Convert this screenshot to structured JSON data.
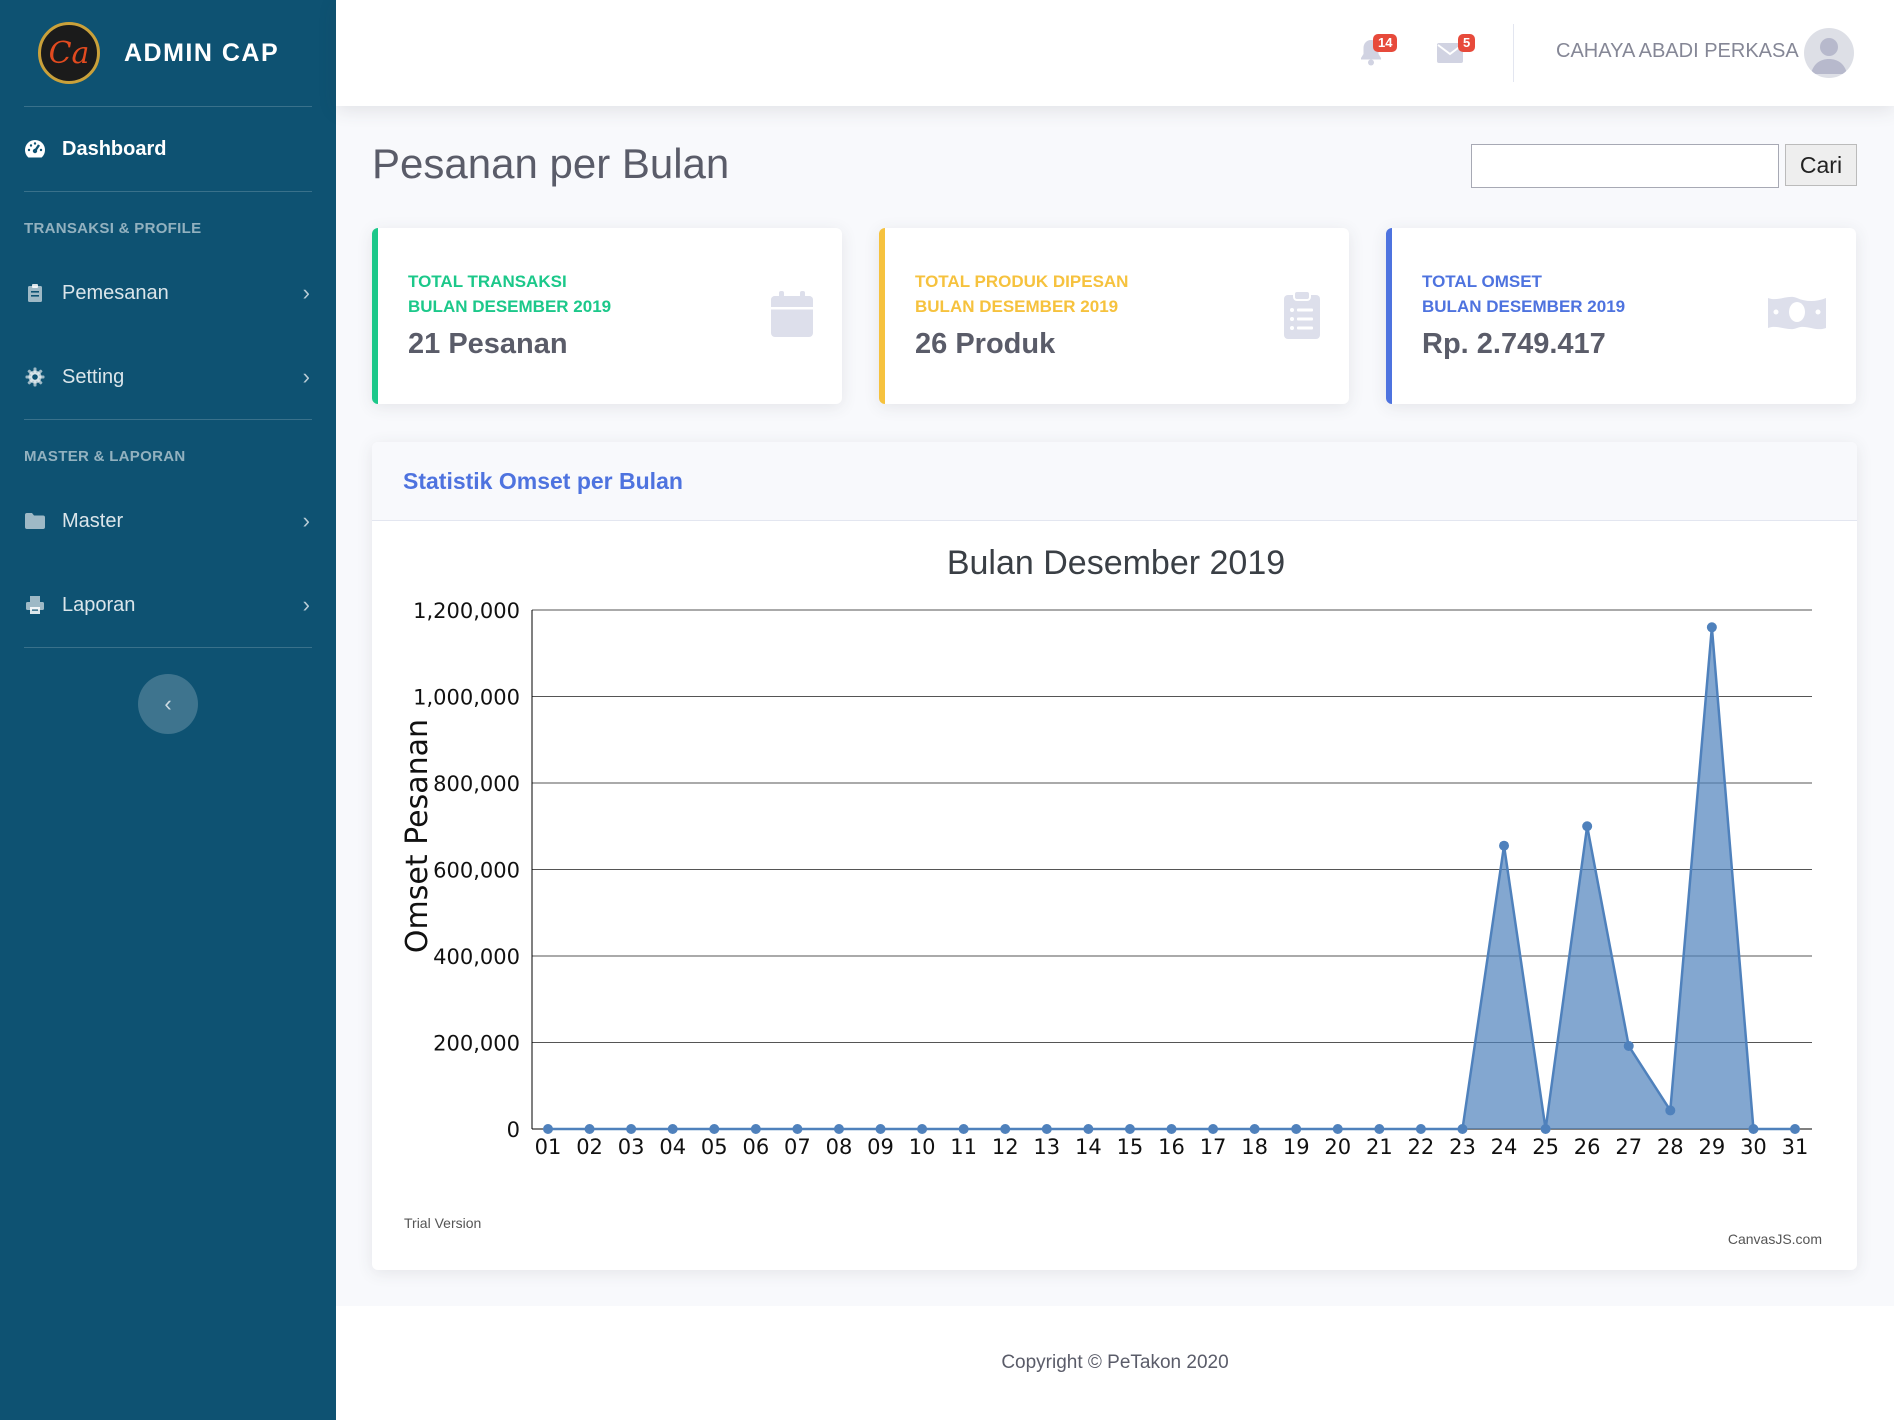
{
  "brand": {
    "name": "ADMIN CAP",
    "logo_text": "Ca"
  },
  "sidebar": {
    "dashboard": "Dashboard",
    "heading1": "TRANSAKSI & PROFILE",
    "heading2": "MASTER & LAPORAN",
    "items": [
      {
        "label": "Pemesanan",
        "icon": "clipboard-icon"
      },
      {
        "label": "Setting",
        "icon": "gear-icon"
      },
      {
        "label": "Master",
        "icon": "folder-icon"
      },
      {
        "label": "Laporan",
        "icon": "printer-icon"
      }
    ],
    "toggle_icon": "chevron-left-icon"
  },
  "topbar": {
    "alerts_count": "14",
    "messages_count": "5",
    "user_name": "CAHAYA ABADI PERKASA"
  },
  "page": {
    "title": "Pesanan per Bulan"
  },
  "search": {
    "value": "",
    "button": "Cari"
  },
  "cards": [
    {
      "line1": "TOTAL TRANSAKSI",
      "line2": "BULAN DESEMBER 2019",
      "value": "21 Pesanan",
      "color": "#1cc88a",
      "icon": "calendar-icon"
    },
    {
      "line1": "TOTAL PRODUK DIPESAN",
      "line2": "BULAN DESEMBER 2019",
      "value": "26 Produk",
      "color": "#f6c23e",
      "icon": "clipboard-list-icon"
    },
    {
      "line1": "TOTAL OMSET",
      "line2": "BULAN DESEMBER 2019",
      "value": "Rp. 2.749.417",
      "color": "#4e73df",
      "icon": "money-icon"
    }
  ],
  "chart_panel": {
    "header": "Statistik Omset per Bulan",
    "watermark": "Trial Version",
    "credit": "CanvasJS.com"
  },
  "colors": {
    "sidebar": "#0e5272",
    "accent": "#4e73df",
    "series": "#4f81bc"
  },
  "chart_data": {
    "type": "area",
    "title": "Bulan Desember 2019",
    "ylabel": "Omset Pesanan",
    "xlabel": "",
    "ylim": [
      0,
      1200000
    ],
    "yticks": [
      0,
      200000,
      400000,
      600000,
      800000,
      1000000,
      1200000
    ],
    "ytick_labels": [
      "0",
      "200,000",
      "400,000",
      "600,000",
      "800,000",
      "1,000,000",
      "1,200,000"
    ],
    "grid": true,
    "categories": [
      "01",
      "02",
      "03",
      "04",
      "05",
      "06",
      "07",
      "08",
      "09",
      "10",
      "11",
      "12",
      "13",
      "14",
      "15",
      "16",
      "17",
      "18",
      "19",
      "20",
      "21",
      "22",
      "23",
      "24",
      "25",
      "26",
      "27",
      "28",
      "29",
      "30",
      "31"
    ],
    "values": [
      0,
      0,
      0,
      0,
      0,
      0,
      0,
      0,
      0,
      0,
      0,
      0,
      0,
      0,
      0,
      0,
      0,
      0,
      0,
      0,
      0,
      0,
      0,
      655000,
      0,
      700000,
      192000,
      43000,
      1160000,
      0,
      0
    ]
  }
}
